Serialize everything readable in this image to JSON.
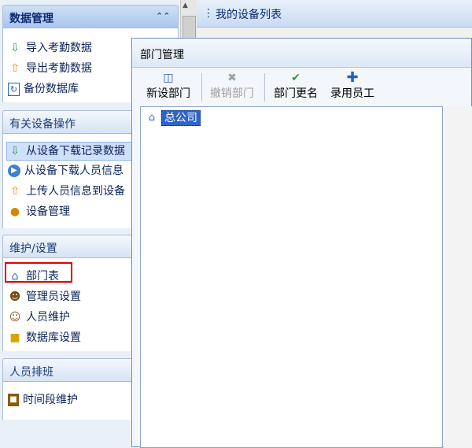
{
  "left_panel": {
    "groups": [
      {
        "title": "数据管理",
        "items": [
          {
            "label": "导入考勤数据",
            "icon": "arrow-down-green-icon"
          },
          {
            "label": "导出考勤数据",
            "icon": "arrow-up-orange-icon"
          },
          {
            "label": "备份数据库",
            "icon": "backup-document-icon"
          }
        ]
      },
      {
        "title": "有关设备操作",
        "items": [
          {
            "label": "从设备下载记录数据",
            "icon": "arrow-down-green-icon"
          },
          {
            "label": "从设备下载人员信息",
            "icon": "download-circle-icon"
          },
          {
            "label": "上传人员信息到设备",
            "icon": "arrow-up-orange-icon"
          },
          {
            "label": "设备管理",
            "icon": "device-cluster-icon"
          }
        ]
      },
      {
        "title": "维护/设置",
        "items": [
          {
            "label": "部门表",
            "icon": "house-icon"
          },
          {
            "label": "管理员设置",
            "icon": "admin-icon"
          },
          {
            "label": "人员维护",
            "icon": "users-icon"
          },
          {
            "label": "数据库设置",
            "icon": "lock-icon"
          }
        ]
      },
      {
        "title": "人员排班",
        "items": [
          {
            "label": "时间段维护",
            "icon": "time-period-icon"
          }
        ]
      }
    ]
  },
  "right_header": {
    "title": "我的设备列表"
  },
  "dialog": {
    "title": "部门管理",
    "toolbar": [
      {
        "label": "新设部门",
        "icon": "new-department-icon",
        "enabled": true
      },
      {
        "label": "撤销部门",
        "icon": "delete-x-icon",
        "enabled": false
      },
      {
        "label": "部门更名",
        "icon": "check-icon",
        "enabled": true
      },
      {
        "label": "录用员工",
        "icon": "plus-icon",
        "enabled": true
      }
    ],
    "tree": {
      "root": "总公司"
    }
  }
}
